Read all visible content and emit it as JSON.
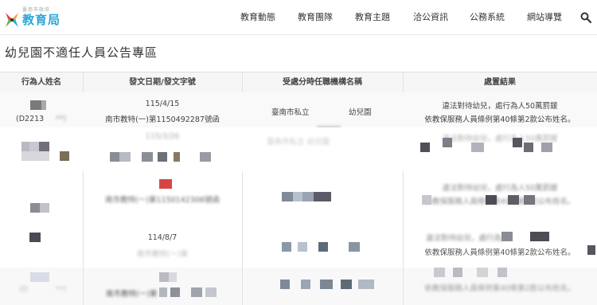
{
  "header": {
    "logo_org": "臺南市政府",
    "logo_name": "教育局",
    "nav": [
      "教育動態",
      "教育團隊",
      "教育主題",
      "洽公資訊",
      "公務系統",
      "網站導覽"
    ]
  },
  "page_title": "幼兒園不適任人員公告專區",
  "table": {
    "columns": [
      "行為人姓名",
      "發文日期/發文字號",
      "受處分時任職機構名稱",
      "處置結果"
    ],
    "rows": [
      {
        "person_id": "(D2213",
        "person_id_tail": "**)",
        "date": "115/4/15",
        "doc_no": "南市教特(一)第1150492287號函",
        "org": "臺南市私立",
        "org_tail": "幼兒園",
        "result1": "違法對待幼兒，處行為人50萬罰鍰",
        "result2": "依教保服務人員條例第40條第2款公布姓名。"
      },
      {
        "date": "115/3/26",
        "org": "臺南市私立    幼兒園",
        "result1": "違法對待幼兒，處行為人50萬罰鍰"
      },
      {
        "doc_no": "南市教特(一)第1150142306號函",
        "result1": "違法對待幼兒，處行為人50萬罰鍰",
        "result2": "依教保服務人員條例第40條第2款公布姓名。"
      },
      {
        "date": "114/8/7",
        "doc_no": "南市教特(一)第",
        "result1": "違法對待幼兒，處行為人",
        "result2": "依教保服務人員條例第40條第2款公布姓名。"
      },
      {
        "person_id": "(D",
        "person_id_tail": "**)",
        "doc_no": "南市教特(一)第",
        "result1": "依教保服務人員條例第40條第2款公布姓名。"
      }
    ]
  },
  "colors": {
    "brand": "#2aa9d9",
    "header_bg": "#f6f6f6"
  },
  "icons": {
    "search": "search-icon",
    "logo": "tainan-logo-icon"
  }
}
